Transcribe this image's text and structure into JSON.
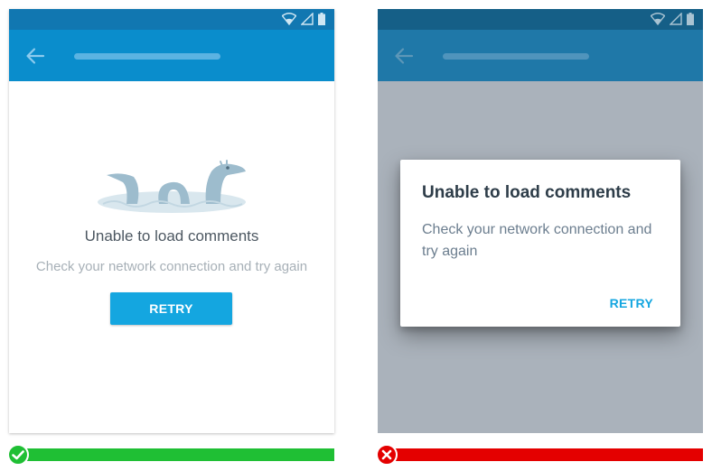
{
  "colors": {
    "appbar_left": "#0a8dcc",
    "statusbar_left": "#1177b1",
    "accent": "#14a6e0",
    "scrim": "#aab2bb",
    "success": "#1fbf34",
    "error": "#e40000"
  },
  "left_screen": {
    "title": "Unable to load comments",
    "message": "Check your network connection and try again",
    "retry_label": "RETRY",
    "illustration": "sea-serpent-illustration"
  },
  "right_screen": {
    "dialog_title": "Unable to load comments",
    "dialog_message": "Check your network connection and try again",
    "retry_label": "RETRY"
  },
  "icons": {
    "status": [
      "wifi-icon",
      "cellular-signal-icon",
      "battery-icon"
    ],
    "back": "back-arrow-icon",
    "good": "checkmark-icon",
    "bad": "close-icon"
  },
  "verdicts": {
    "left": "correct",
    "right": "incorrect"
  }
}
